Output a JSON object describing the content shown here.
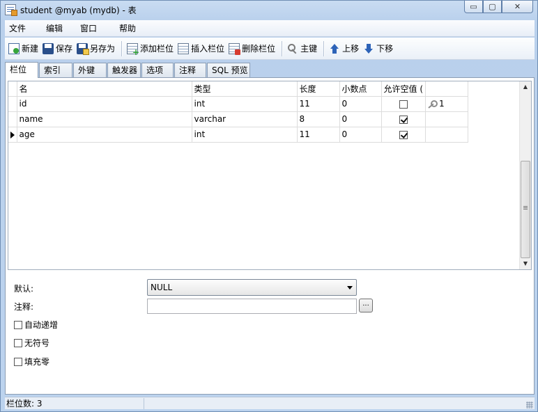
{
  "window": {
    "title": "student @myab (mydb) - 表",
    "controls": {
      "minimize": "▭",
      "maximize": "▢",
      "close": "✕"
    }
  },
  "menu": {
    "items": [
      "文件",
      "编辑",
      "窗口",
      "帮助"
    ]
  },
  "toolbar": {
    "new": "新建",
    "save": "保存",
    "save_as": "另存为",
    "add_column": "添加栏位",
    "insert_column": "插入栏位",
    "delete_column": "删除栏位",
    "primary_key": "主键",
    "move_up": "上移",
    "move_down": "下移"
  },
  "tabs": [
    "栏位",
    "索引",
    "外键",
    "触发器",
    "选项",
    "注释",
    "SQL 预览"
  ],
  "grid": {
    "headers": [
      "名",
      "类型",
      "长度",
      "小数点",
      "允许空值 (",
      ""
    ],
    "rows": [
      {
        "name": "id",
        "type": "int",
        "length": "11",
        "decimals": "0",
        "allow_null": false,
        "key": "1"
      },
      {
        "name": "name",
        "type": "varchar",
        "length": "8",
        "decimals": "0",
        "allow_null": true,
        "key": ""
      },
      {
        "name": "age",
        "type": "int",
        "length": "11",
        "decimals": "0",
        "allow_null": true,
        "key": ""
      }
    ],
    "current_row": 2
  },
  "properties": {
    "default_label": "默认:",
    "default_value": "NULL",
    "comment_label": "注释:",
    "comment_value": "",
    "ellipsis": "...",
    "auto_increment_label": "自动递增",
    "unsigned_label": "无符号",
    "zerofill_label": "填充零"
  },
  "status": {
    "column_count": "栏位数: 3"
  }
}
